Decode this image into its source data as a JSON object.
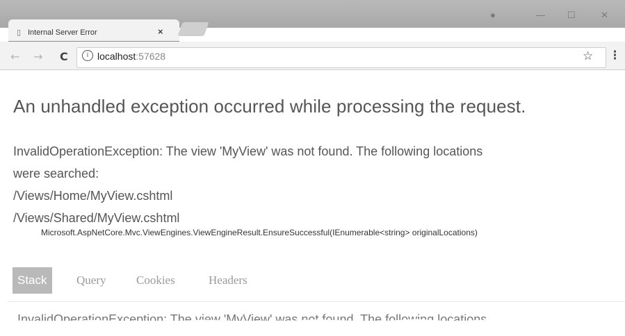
{
  "browser": {
    "tab_title": "Internal Server Error",
    "tab_close": "×",
    "url_host": "localhost",
    "url_port": ":57628",
    "info_glyph": "i",
    "icons": {
      "back": "back-arrow-icon",
      "forward": "forward-arrow-icon",
      "reload": "reload-icon",
      "info": "info-icon",
      "bookmark": "star-icon",
      "menu": "kebab-menu-icon",
      "minimize": "minimize-icon",
      "maximize": "maximize-icon",
      "close": "close-icon",
      "profile": "profile-icon"
    }
  },
  "page": {
    "heading": "An unhandled exception occurred while processing the request.",
    "message_lines": [
      "InvalidOperationException: The view 'MyView' was not found. The following locations",
      "were searched:",
      "/Views/Home/MyView.cshtml",
      "/Views/Shared/MyView.cshtml"
    ],
    "location": "Microsoft.AspNetCore.Mvc.ViewEngines.ViewEngineResult.EnsureSuccessful(IEnumerable<string> originalLocations)",
    "tabs": [
      {
        "label": "Stack",
        "active": true
      },
      {
        "label": "Query",
        "active": false
      },
      {
        "label": "Cookies",
        "active": false
      },
      {
        "label": "Headers",
        "active": false
      }
    ],
    "torn_text": "InvalidOperationException: The view 'MyView' was not found. The following locations"
  }
}
